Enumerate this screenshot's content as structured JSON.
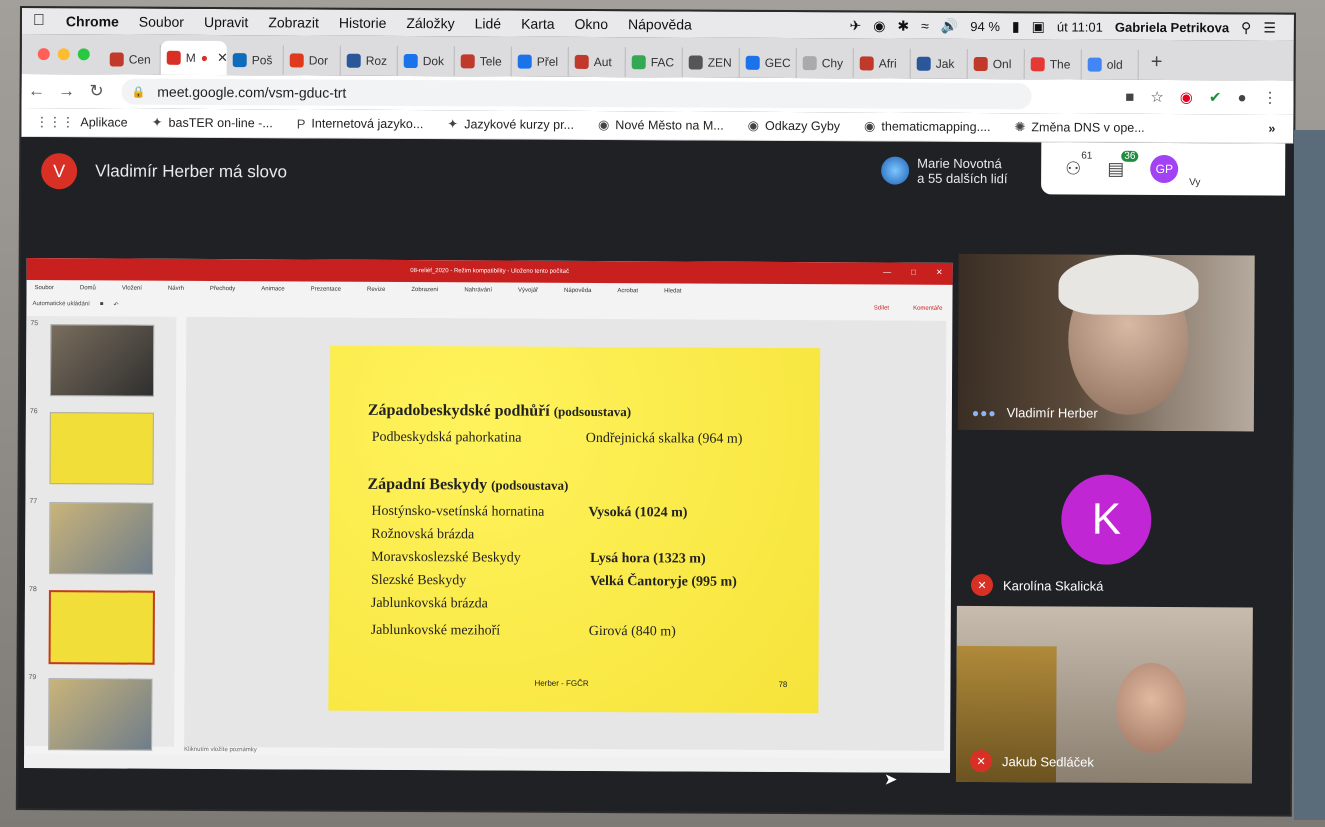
{
  "menubar": {
    "app": "Chrome",
    "items": [
      "Soubor",
      "Upravit",
      "Zobrazit",
      "Historie",
      "Záložky",
      "Lidé",
      "Karta",
      "Okno",
      "Nápověda"
    ],
    "battery": "94 %",
    "clock": "út 11:01",
    "user": "Gabriela Petrikova"
  },
  "tabs": [
    {
      "label": "Cen",
      "color": "#c0392b"
    },
    {
      "label": "M",
      "color": "#d93025",
      "active": true
    },
    {
      "label": "Poš",
      "color": "#0f6cbd"
    },
    {
      "label": "Dor",
      "color": "#e03a1e"
    },
    {
      "label": "Roz",
      "color": "#2b579a"
    },
    {
      "label": "Dok",
      "color": "#1a73e8"
    },
    {
      "label": "Tele",
      "color": "#c0392b"
    },
    {
      "label": "Přel",
      "color": "#1a73e8"
    },
    {
      "label": "Aut",
      "color": "#c0392b"
    },
    {
      "label": "FAC",
      "color": "#34a853"
    },
    {
      "label": "ZEN",
      "color": "#555555"
    },
    {
      "label": "GEC",
      "color": "#1a73e8"
    },
    {
      "label": "Chy",
      "color": "#aaaaaa"
    },
    {
      "label": "Afri",
      "color": "#c0392b"
    },
    {
      "label": "Jak",
      "color": "#2b579a"
    },
    {
      "label": "Onl",
      "color": "#c0392b"
    },
    {
      "label": "The",
      "color": "#e53935"
    },
    {
      "label": "old",
      "color": "#4285f4"
    }
  ],
  "address": {
    "url": "meet.google.com/vsm-gduc-trt"
  },
  "bookmarks": [
    {
      "label": "Aplikace",
      "icon": "apps-grid-icon"
    },
    {
      "label": "basTER on-line -...",
      "icon": "bookmark-icon"
    },
    {
      "label": "Internetová jazyko...",
      "icon": "p-icon"
    },
    {
      "label": "Jazykové kurzy pr...",
      "icon": "bookmark-icon"
    },
    {
      "label": "Nové Město na M...",
      "icon": "globe-icon"
    },
    {
      "label": "Odkazy Gyby",
      "icon": "globe-icon"
    },
    {
      "label": "thematicmapping....",
      "icon": "globe-icon"
    },
    {
      "label": "Změna DNS v ope...",
      "icon": "gear-icon"
    }
  ],
  "meet": {
    "speaker_initial": "V",
    "speaker_text": "Vladimír Herber má slovo",
    "presenting_line1": "Marie Novotná",
    "presenting_line2": "a 55 dalších lidí",
    "people_count": "61",
    "chat_count": "36",
    "self_initials": "GP",
    "self_label": "Vy"
  },
  "participants": [
    {
      "name": "Vladimír Herber",
      "muted": false
    },
    {
      "name": "Karolína Skalická",
      "initial": "K",
      "muted": true
    },
    {
      "name": "Jakub Sedláček",
      "muted": true
    }
  ],
  "slide": {
    "heading1": "Západobeskydské podhůří",
    "heading1_sub": "(podsoustava)",
    "row1_name": "Podbeskydská pahorkatina",
    "row1_val": "Ondřejnická skalka (964 m)",
    "heading2": "Západní Beskydy",
    "heading2_sub": "(podsoustava)",
    "rows": [
      {
        "name": "Hostýnsko-vsetínská hornatina",
        "val": "Vysoká (1024 m)",
        "bold": true
      },
      {
        "name": "Rožnovská brázda",
        "val": "",
        "bold": false
      },
      {
        "name": "Moravskoslezské Beskydy",
        "val": "Lysá hora (1323 m)",
        "bold": true
      },
      {
        "name": "Slezské Beskydy",
        "val": "Velká Čantoryje (995 m)",
        "bold": true
      },
      {
        "name": "Jablunkovská brázda",
        "val": "",
        "bold": false
      },
      {
        "name": "Jablunkovské mezihoří",
        "val": "Girová (840 m)",
        "bold": false
      }
    ],
    "footer": "Herber - FGČR",
    "page": "78"
  },
  "ppt": {
    "title": "08-reliéf_2020 - Režim kompatibility - Uloženo tento počítač",
    "menu": [
      "Soubor",
      "Domů",
      "Vložení",
      "Návrh",
      "Přechody",
      "Animace",
      "Prezentace",
      "Revize",
      "Zobrazení",
      "Nahrávání",
      "Vývojář",
      "Nápověda",
      "Acrobat",
      "Hledat"
    ],
    "autosave": "Automatické ukládání",
    "thumb_numbers": [
      "75",
      "76",
      "77",
      "78",
      "79"
    ],
    "notes": "Kliknutím vložíte poznámky",
    "share": "Sdílet",
    "comments": "Komentáře"
  },
  "colors": {
    "meet_bg": "#202124",
    "ppt_red": "#c8201f",
    "slide_yellow": "#f6e33a",
    "avatar_purple": "#c026d3"
  }
}
